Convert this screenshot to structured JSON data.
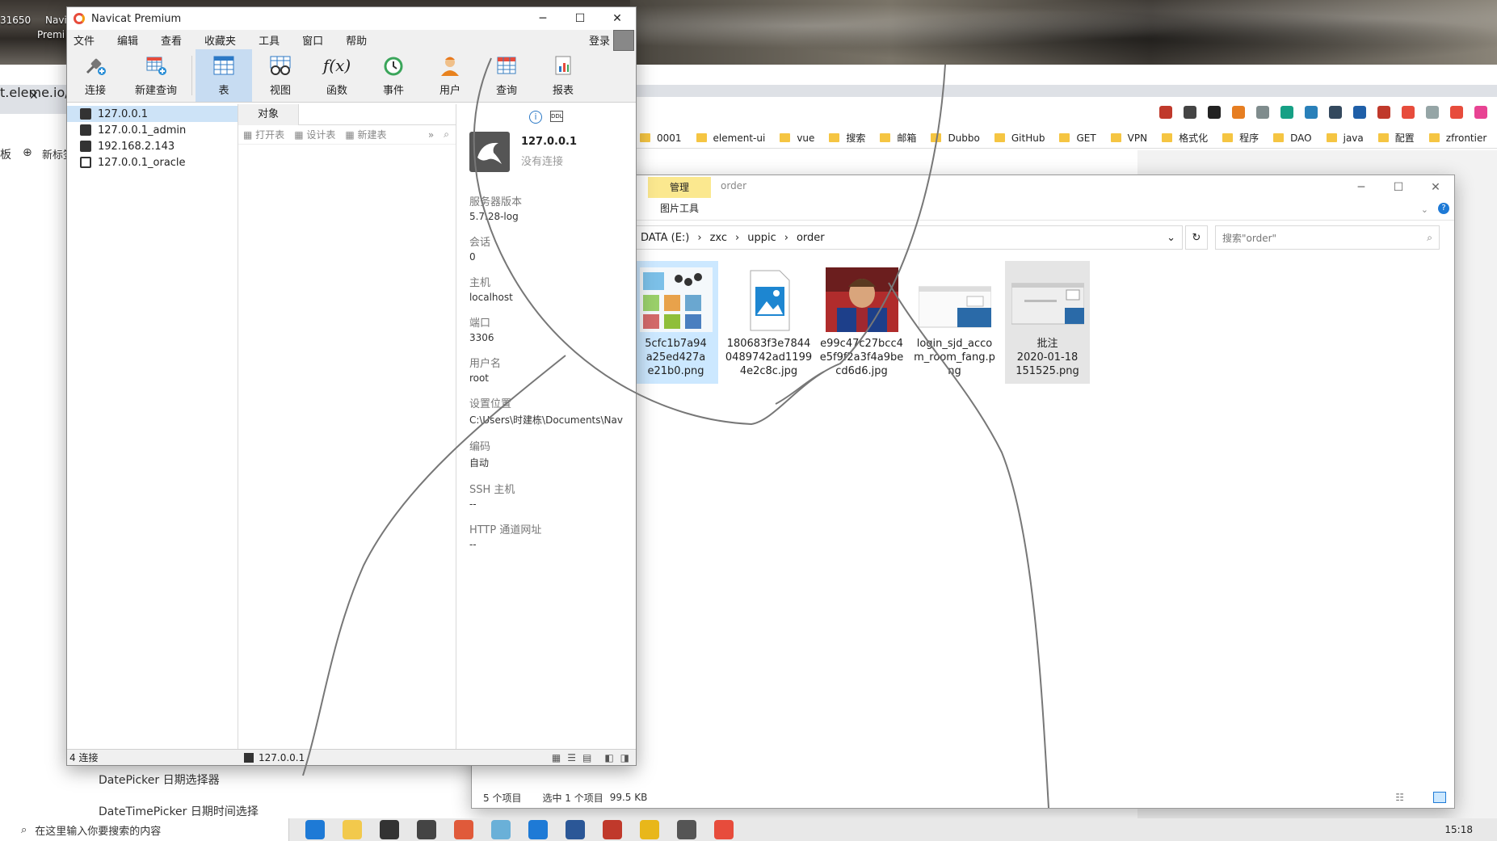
{
  "desktop": {
    "labels": [
      "31650",
      "Navi",
      "Premi"
    ]
  },
  "browser": {
    "address_fragment": "t.eleme.io/#",
    "left_tab": "板",
    "new_tab_label": "新标签",
    "bookmarks": [
      "0001",
      "element-ui",
      "vue",
      "搜索",
      "邮箱",
      "Dubbo",
      "GitHub",
      "GET",
      "VPN",
      "格式化",
      "程序",
      "DAO",
      "java",
      "配置",
      "zfrontier"
    ],
    "sidebar_items": [
      "DatePicker 日期选择器",
      "DateTimePicker 日期时间选择"
    ]
  },
  "navicat": {
    "title": "Navicat Premium",
    "menu": [
      "文件",
      "编辑",
      "查看",
      "收藏夹",
      "工具",
      "窗口",
      "帮助"
    ],
    "login": "登录",
    "toolbar": [
      "连接",
      "新建查询",
      "表",
      "视图",
      "函数",
      "事件",
      "用户",
      "查询",
      "报表"
    ],
    "connections": [
      "127.0.0.1",
      "127.0.0.1_admin",
      "192.168.2.143",
      "127.0.0.1_oracle"
    ],
    "object_tab": "对象",
    "object_actions": [
      "打开表",
      "设计表",
      "新建表"
    ],
    "info": {
      "host": "127.0.0.1",
      "status": "没有连接",
      "fields": [
        {
          "label": "服务器版本",
          "value": "5.7.28-log"
        },
        {
          "label": "会话",
          "value": "0"
        },
        {
          "label": "主机",
          "value": "localhost"
        },
        {
          "label": "端口",
          "value": "3306"
        },
        {
          "label": "用户名",
          "value": "root"
        },
        {
          "label": "设置位置",
          "value": "C:\\Users\\时建栋\\Documents\\Nav"
        },
        {
          "label": "编码",
          "value": "自动"
        },
        {
          "label": "SSH 主机",
          "value": "--"
        },
        {
          "label": "HTTP 通道网址",
          "value": "--"
        }
      ]
    },
    "status": {
      "count": "4 连接",
      "current": "127.0.0.1"
    }
  },
  "explorer": {
    "manage": "管理",
    "picture_tools": "图片工具",
    "window_title": "order",
    "path": [
      "DATA (E:)",
      "zxc",
      "uppic",
      "order"
    ],
    "search_placeholder": "搜索\"order\"",
    "files": [
      {
        "name": "5cfc1b7a94a25ed427ae21b0.png",
        "lines": [
          "5cfc1b7a94",
          "a25ed427a",
          "e21b0.png"
        ]
      },
      {
        "name": "180683f3e78440489742ad11994e2c8c.jpg",
        "lines": [
          "180683f3e7844",
          "0489742ad1199",
          "4e2c8c.jpg"
        ]
      },
      {
        "name": "e99c47c27bcc4e5f9f2a3f4a9becd6d6.jpg",
        "lines": [
          "e99c47c27bcc4",
          "e5f9f2a3f4a9be",
          "cd6d6.jpg"
        ]
      },
      {
        "name": "login_sjd_accom_room_fang.png",
        "lines": [
          "login_sjd_acco",
          "m_room_fang.p",
          "ng"
        ]
      },
      {
        "name": "批注 2020-01-18 151525.png",
        "lines": [
          "批注",
          "2020-01-18",
          "151525.png"
        ]
      }
    ],
    "status": {
      "items": "5 个项目",
      "selected": "选中 1 个项目",
      "size": "99.5 KB"
    }
  },
  "taskbar": {
    "search_placeholder": "在这里输入你要搜索的内容",
    "time": "15:18"
  }
}
